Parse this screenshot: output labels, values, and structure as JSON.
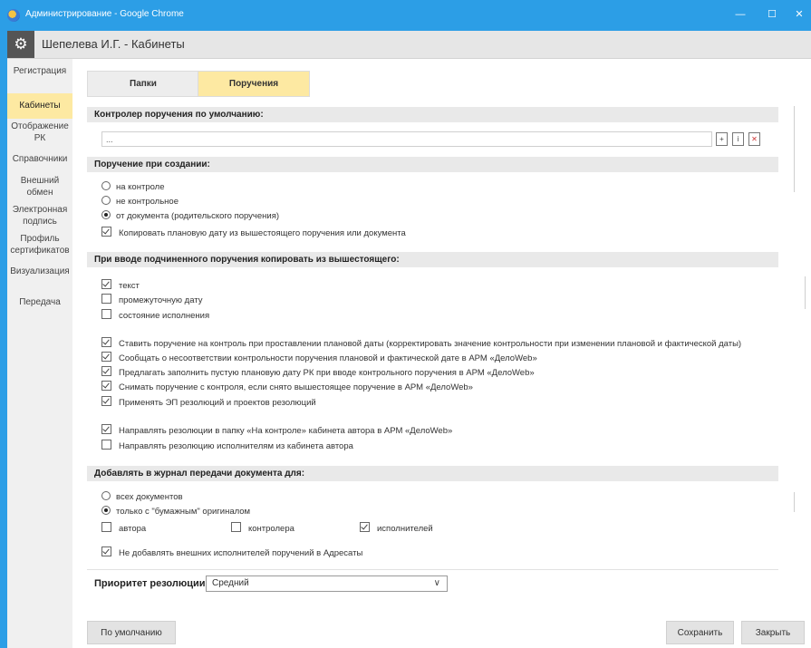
{
  "window": {
    "title": "Администрирование - Google Chrome"
  },
  "header": {
    "title": "Шепелева И.Г. - Кабинеты"
  },
  "sidebar": {
    "items": [
      {
        "label": "Регистрация"
      },
      {
        "label": "Кабинеты"
      },
      {
        "label": "Отображение РК"
      },
      {
        "label": "Справочники"
      },
      {
        "label": "Внешний обмен"
      },
      {
        "label": "Электронная подпись"
      },
      {
        "label": "Профиль сертификатов"
      },
      {
        "label": "Визуализация"
      },
      {
        "label": "Передача"
      }
    ]
  },
  "tabs": [
    {
      "label": "Папки"
    },
    {
      "label": "Поручения"
    }
  ],
  "controller": {
    "title": "Контролер поручения по умолчанию:",
    "value": "..."
  },
  "creation": {
    "title": "Поручение при создании:",
    "options": [
      "на контроле",
      "не контрольное",
      "от документа (родительского поручения)"
    ],
    "copy_date": "Копировать плановую дату из вышестоящего поручения или документа"
  },
  "subordinate": {
    "title": "При вводе подчиненного поручения копировать из вышестоящего:",
    "items": [
      "текст",
      "промежуточную дату",
      "состояние исполнения"
    ]
  },
  "options": [
    "Ставить поручение на контроль при проставлении плановой даты (корректировать значение контрольности при изменении плановой и фактической даты)",
    "Сообщать о несоответствии контрольности поручения плановой и фактической дате в АРМ «ДелоWeb»",
    "Предлагать заполнить пустую плановую дату РК при вводе контрольного поручения в АРМ «ДелоWeb»",
    "Снимать поручение с контроля, если снято вышестоящее поручение в АРМ «ДелоWeb»",
    "Применять ЭП резолюций и проектов резолюций",
    "Направлять резолюции в папку «На контроле» кабинета автора в АРМ «ДелоWeb»",
    "Направлять резолюцию исполнителям из кабинета автора"
  ],
  "journal": {
    "title": "Добавлять в журнал передачи документа для:",
    "options": [
      "всех документов",
      "только с \"бумажным\" оригиналом"
    ],
    "roles": [
      "автора",
      "контролера",
      "исполнителей"
    ],
    "external": "Не добавлять внешних исполнителей поручений в Адресаты"
  },
  "priority": {
    "label": "Приоритет резолюции",
    "value": "Средний"
  },
  "buttons": {
    "default": "По умолчанию",
    "save": "Сохранить",
    "close": "Закрыть"
  }
}
